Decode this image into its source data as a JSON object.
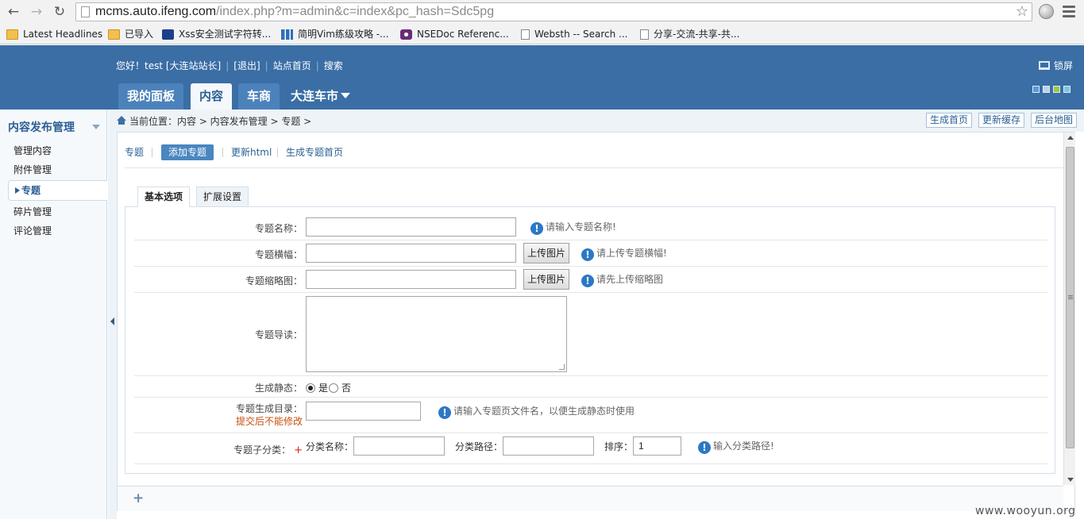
{
  "browser": {
    "url_host": "mcms.auto.ifeng.com",
    "url_path": "/index.php?m=admin&c=index&pc_hash=Sdc5pg",
    "bookmarks": [
      {
        "label": "Latest Headlines",
        "icon": "folder-icon"
      },
      {
        "label": "已导入",
        "icon": "folder-icon"
      },
      {
        "label": "Xss安全测试字符转...",
        "icon": "paw-icon"
      },
      {
        "label": "简明Vim练级攻略 -...",
        "icon": "bars-icon"
      },
      {
        "label": "NSEDoc Referenc...",
        "icon": "eye-icon"
      },
      {
        "label": "Websth -- Search ...",
        "icon": "page-icon"
      },
      {
        "label": "分享-交流-共享-共...",
        "icon": "page-icon"
      }
    ]
  },
  "header": {
    "greeting": "您好！test [大连站站长]",
    "logout": "[退出]",
    "site_home": "站点首页",
    "search": "搜索",
    "lock": "锁屏",
    "skin_colors": [
      "#5a9ad8",
      "#bcd3ea",
      "#9bc74c",
      "#7fc4e0"
    ],
    "tabs": [
      "我的面板",
      "内容",
      "车商",
      "大连车市"
    ]
  },
  "sidebar": {
    "title": "内容发布管理",
    "items": [
      "管理内容",
      "附件管理",
      "专题",
      "碎片管理",
      "评论管理"
    ]
  },
  "breadcrumb": {
    "text": "当前位置：内容 > 内容发布管理 > 专题 >",
    "buttons": [
      "生成首页",
      "更新缓存",
      "后台地图"
    ]
  },
  "subnav": [
    "专题",
    "添加专题",
    "更新html",
    "生成专题首页"
  ],
  "form_tabs": [
    "基本选项",
    "扩展设置"
  ],
  "form": {
    "name_label": "专题名称：",
    "name_tip": "请输入专题名称!",
    "banner_label": "专题横幅：",
    "banner_tip": "请上传专题横幅!",
    "thumb_label": "专题缩略图：",
    "thumb_tip": "请先上传缩略图",
    "upload_label": "上传图片",
    "intro_label": "专题导读：",
    "static_label": "生成静态：",
    "static_yes": "是",
    "static_no": "否",
    "dir_label": "专题生成目录：",
    "dir_warn": "提交后不能修改",
    "dir_tip": "请输入专题页文件名，以便生成静态时使用",
    "sub_label": "专题子分类：",
    "sub_required": "+",
    "cat_name_label": "分类名称：",
    "cat_path_label": "分类路径：",
    "sort_label": "排序：",
    "sort_value": "1",
    "sub_tip": "输入分类路径!"
  },
  "watermark": "www.wooyun.org"
}
